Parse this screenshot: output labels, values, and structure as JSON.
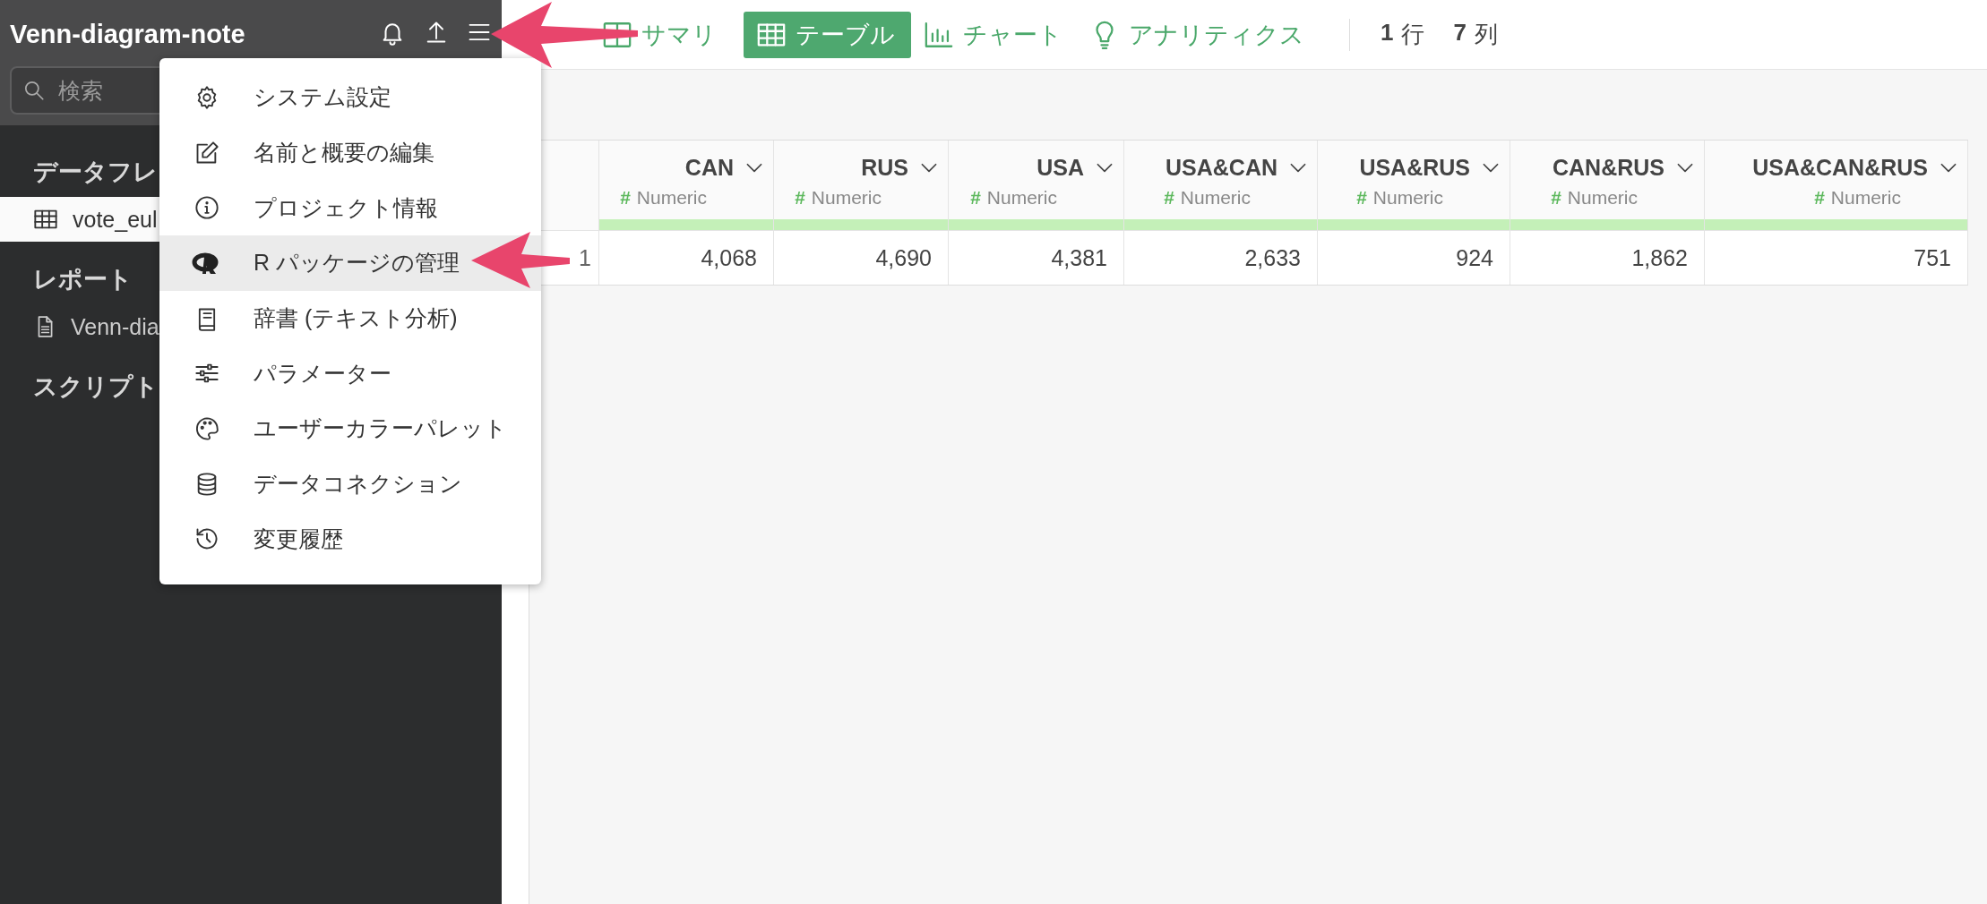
{
  "sidebar": {
    "title": "Venn-diagram-note",
    "search": {
      "placeholder": "検索"
    },
    "sections": [
      {
        "heading": "データフレ",
        "items": [
          {
            "label": "vote_eul",
            "kind": "table",
            "selected": true
          }
        ]
      },
      {
        "heading": "レポート",
        "items": [
          {
            "label": "Venn-dia",
            "kind": "document",
            "selected": false
          }
        ]
      },
      {
        "heading": "スクリプト"
      }
    ]
  },
  "menu": {
    "items": [
      {
        "label": "システム設定",
        "selected": false
      },
      {
        "label": "名前と概要の編集",
        "selected": false
      },
      {
        "label": "プロジェクト情報",
        "selected": false
      },
      {
        "label": "R パッケージの管理",
        "selected": true
      },
      {
        "label": "辞書 (テキスト分析)",
        "selected": false
      },
      {
        "label": "パラメーター",
        "selected": false
      },
      {
        "label": "ユーザーカラーパレット",
        "selected": false
      },
      {
        "label": "データコネクション",
        "selected": false
      },
      {
        "label": "変更履歴",
        "selected": false
      }
    ]
  },
  "toolbar": {
    "tabs": [
      {
        "label": "サマリ",
        "selected": false
      },
      {
        "label": "テーブル",
        "selected": true
      },
      {
        "label": "チャート",
        "selected": false
      },
      {
        "label": "アナリティクス",
        "selected": false
      }
    ],
    "row_count": {
      "number": "1",
      "unit": "行"
    },
    "column_count": {
      "number": "7",
      "unit": "列"
    }
  },
  "table": {
    "columns": [
      {
        "name": "CAN",
        "type_symbol": "#",
        "type": "Numeric"
      },
      {
        "name": "RUS",
        "type_symbol": "#",
        "type": "Numeric"
      },
      {
        "name": "USA",
        "type_symbol": "#",
        "type": "Numeric"
      },
      {
        "name": "USA&CAN",
        "type_symbol": "#",
        "type": "Numeric"
      },
      {
        "name": "USA&RUS",
        "type_symbol": "#",
        "type": "Numeric"
      },
      {
        "name": "CAN&RUS",
        "type_symbol": "#",
        "type": "Numeric"
      },
      {
        "name": "USA&CAN&RUS",
        "type_symbol": "#",
        "type": "Numeric"
      }
    ],
    "rows": [
      {
        "number": "1",
        "cells": [
          "4,068",
          "4,690",
          "4,381",
          "2,633",
          "924",
          "1,862",
          "751"
        ]
      }
    ]
  }
}
